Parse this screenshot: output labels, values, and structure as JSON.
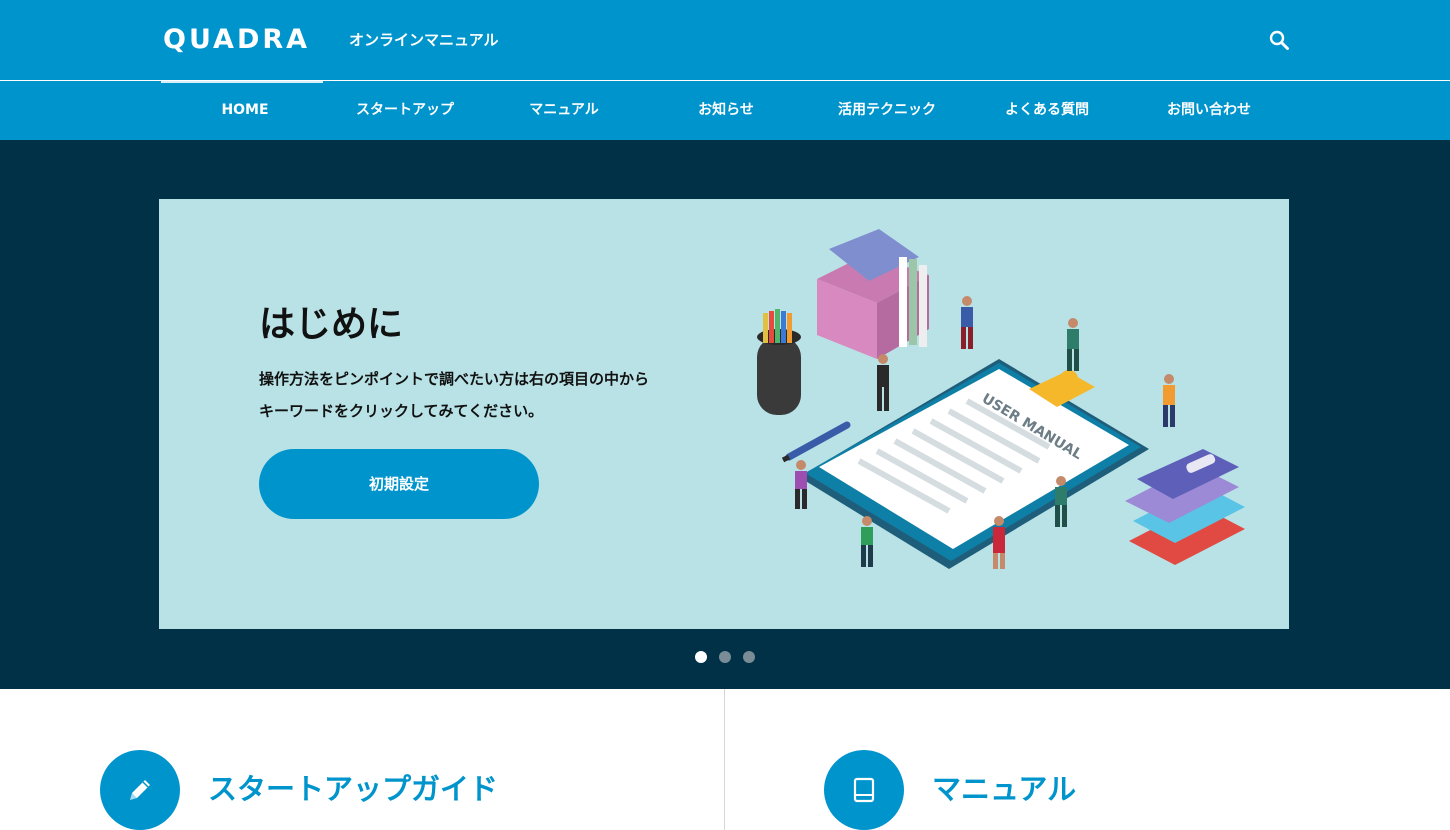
{
  "header": {
    "logo": "QUADRA",
    "subtitle": "オンラインマニュアル",
    "search_icon": "search-icon"
  },
  "nav": {
    "items": [
      {
        "label": "HOME",
        "active": true
      },
      {
        "label": "スタートアップ"
      },
      {
        "label": "マニュアル"
      },
      {
        "label": "お知らせ"
      },
      {
        "label": "活用テクニック"
      },
      {
        "label": "よくある質問"
      },
      {
        "label": "お問い合わせ"
      }
    ]
  },
  "hero": {
    "title": "はじめに",
    "text": "操作方法をピンポイントで調べたい方は右の項目の中からキーワードをクリックしてみてください。",
    "button": "初期設定",
    "illustration_text": "USER MANUAL",
    "slides_total": 3,
    "active_slide": 1
  },
  "guides": [
    {
      "label": "スタートアップガイド",
      "icon": "pencil-icon"
    },
    {
      "label": "マニュアル",
      "icon": "book-icon"
    }
  ],
  "colors": {
    "brand": "#0094cc",
    "hero_bg": "#003147",
    "slide_bg": "#b8e2e6"
  }
}
